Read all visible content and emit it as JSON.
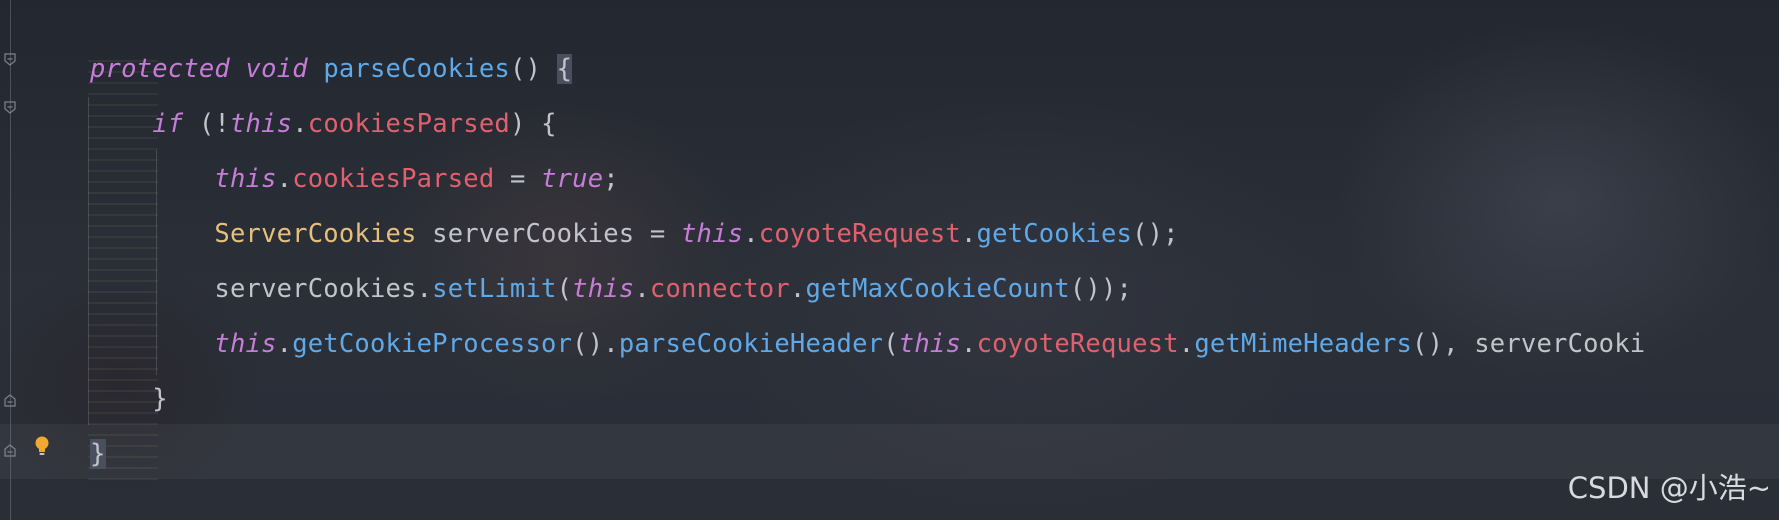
{
  "code": {
    "lines": [
      [
        {
          "t": "protected",
          "c": "kw"
        },
        {
          "t": " ",
          "c": "txt"
        },
        {
          "t": "void",
          "c": "kw"
        },
        {
          "t": " ",
          "c": "txt"
        },
        {
          "t": "parseCookies",
          "c": "fn"
        },
        {
          "t": "() ",
          "c": "txt"
        },
        {
          "t": "{",
          "c": "txt brace-hl"
        }
      ],
      [
        {
          "t": "    ",
          "c": "txt"
        },
        {
          "t": "if",
          "c": "kw"
        },
        {
          "t": " (!",
          "c": "txt"
        },
        {
          "t": "this",
          "c": "kw"
        },
        {
          "t": ".",
          "c": "txt"
        },
        {
          "t": "cookiesParsed",
          "c": "fld"
        },
        {
          "t": ") {",
          "c": "txt"
        }
      ],
      [
        {
          "t": "        ",
          "c": "txt"
        },
        {
          "t": "this",
          "c": "kw"
        },
        {
          "t": ".",
          "c": "txt"
        },
        {
          "t": "cookiesParsed",
          "c": "fld"
        },
        {
          "t": " = ",
          "c": "txt"
        },
        {
          "t": "true",
          "c": "kw"
        },
        {
          "t": ";",
          "c": "txt"
        }
      ],
      [
        {
          "t": "        ",
          "c": "txt"
        },
        {
          "t": "ServerCookies",
          "c": "cls"
        },
        {
          "t": " serverCookies = ",
          "c": "txt"
        },
        {
          "t": "this",
          "c": "kw"
        },
        {
          "t": ".",
          "c": "txt"
        },
        {
          "t": "coyoteRequest",
          "c": "fld"
        },
        {
          "t": ".",
          "c": "txt"
        },
        {
          "t": "getCookies",
          "c": "fn"
        },
        {
          "t": "();",
          "c": "txt"
        }
      ],
      [
        {
          "t": "        serverCookies.",
          "c": "txt"
        },
        {
          "t": "setLimit",
          "c": "fn"
        },
        {
          "t": "(",
          "c": "txt"
        },
        {
          "t": "this",
          "c": "kw"
        },
        {
          "t": ".",
          "c": "txt"
        },
        {
          "t": "connector",
          "c": "fld"
        },
        {
          "t": ".",
          "c": "txt"
        },
        {
          "t": "getMaxCookieCount",
          "c": "fn"
        },
        {
          "t": "());",
          "c": "txt"
        }
      ],
      [
        {
          "t": "        ",
          "c": "txt"
        },
        {
          "t": "this",
          "c": "kw"
        },
        {
          "t": ".",
          "c": "txt"
        },
        {
          "t": "getCookieProcessor",
          "c": "fn"
        },
        {
          "t": "().",
          "c": "txt"
        },
        {
          "t": "parseCookieHeader",
          "c": "fn"
        },
        {
          "t": "(",
          "c": "txt"
        },
        {
          "t": "this",
          "c": "kw"
        },
        {
          "t": ".",
          "c": "txt"
        },
        {
          "t": "coyoteRequest",
          "c": "fld"
        },
        {
          "t": ".",
          "c": "txt"
        },
        {
          "t": "getMimeHeaders",
          "c": "fn"
        },
        {
          "t": "(), serverCooki",
          "c": "txt"
        }
      ],
      [
        {
          "t": "    }",
          "c": "txt"
        }
      ],
      [
        {
          "t": "}",
          "c": "txt brace-hl"
        }
      ]
    ]
  },
  "gutter": {
    "fold_icon": "fold-marker-icon",
    "bulb_icon": "lightbulb-icon",
    "bulb_color": "#f0a830"
  },
  "watermark": {
    "text": "CSDN @小浩~"
  },
  "colors": {
    "keyword": "#c77dd8",
    "function": "#5fa9e8",
    "field": "#e0616d",
    "class": "#e5c07b",
    "text": "#c1c4ca"
  }
}
